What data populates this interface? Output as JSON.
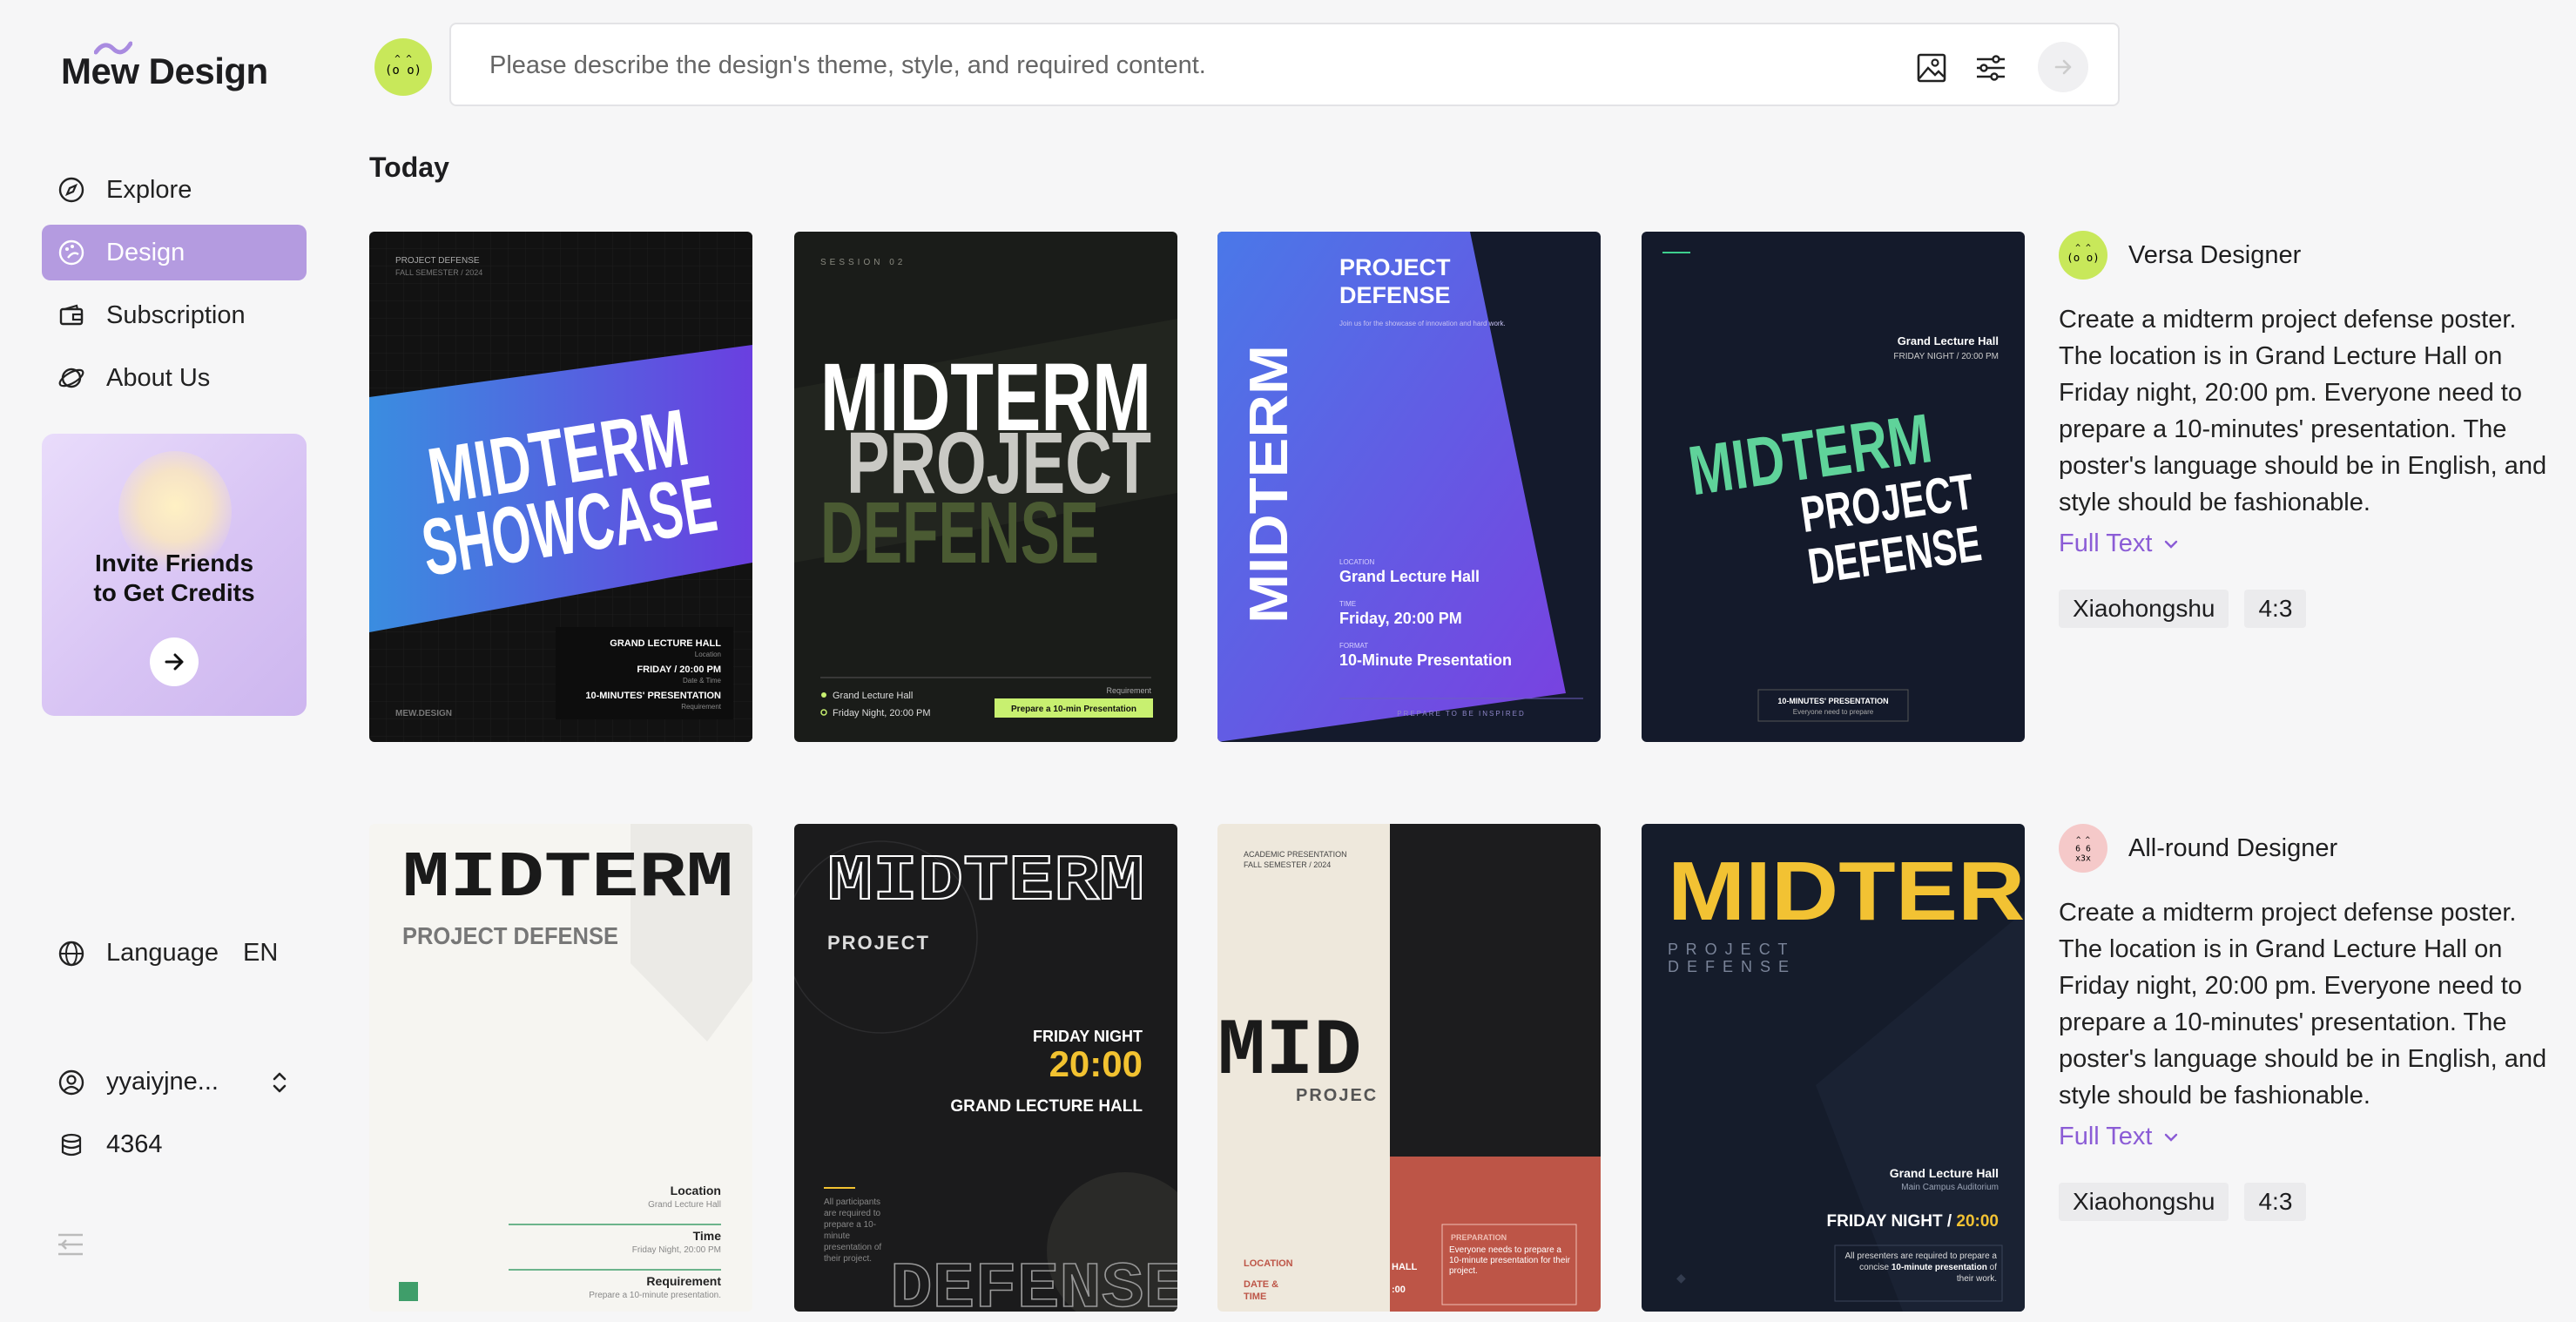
{
  "app": {
    "logo": "Mew Design"
  },
  "nav": [
    {
      "label": "Explore",
      "icon": "compass-icon"
    },
    {
      "label": "Design",
      "icon": "palette-icon",
      "active": true
    },
    {
      "label": "Subscription",
      "icon": "wallet-icon"
    },
    {
      "label": "About Us",
      "icon": "planet-icon"
    }
  ],
  "promo": {
    "line1": "Invite Friends",
    "line2": "to Get Credits"
  },
  "language": {
    "label": "Language",
    "code": "EN"
  },
  "user": {
    "name": "yyaiyjne...",
    "credits": "4364"
  },
  "prompt": {
    "placeholder": "Please describe the design's theme, style, and required content."
  },
  "section": {
    "title": "Today"
  },
  "colors": {
    "accent": "#b49be0",
    "link": "#8b5cd6"
  },
  "rows": [
    {
      "designer": "Versa Designer",
      "description": "Create a midterm project defense poster. The location is in Grand Lecture Hall on Friday night, 20:00 pm. Everyone need to prepare a 10-minutes' presentation. The poster's language should be in English, and style should be fashionable.",
      "full_text": "Full Text",
      "tags": [
        "Xiaohongshu",
        "4:3"
      ]
    },
    {
      "designer": "All-round Designer",
      "description": "Create a midterm project defense poster. The location is in Grand Lecture Hall on Friday night, 20:00 pm. Everyone need to prepare a 10-minutes' presentation. The poster's language should be in English, and style should be fashionable.",
      "full_text": "Full Text",
      "tags": [
        "Xiaohongshu",
        "4:3"
      ]
    }
  ],
  "posters": {
    "p1": {
      "top": "PROJECT DEFENSE",
      "sub": "FALL SEMESTER / 2024",
      "title1": "MIDTERM",
      "title2": "SHOWCASE",
      "l1": "GRAND LECTURE HALL",
      "l1s": "Location",
      "l2": "FRIDAY / 20:00 PM",
      "l2s": "Date & Time",
      "l3": "10-MINUTES' PRESENTATION",
      "l3s": "Requirement",
      "brand": "MEW.DESIGN"
    },
    "p2": {
      "top": "SESSION 02",
      "t1": "MIDTERM",
      "t2": "PROJECT",
      "t3": "DEFENSE",
      "b1": "Grand Lecture Hall",
      "b2": "Friday Night, 20:00 PM",
      "req": "Requirement",
      "badge": "Prepare a 10-min Presentation"
    },
    "p3": {
      "t1": "PROJECT",
      "t2": "DEFENSE",
      "sub": "Join us for the showcase of innovation and hard work.",
      "vert": "MIDTERM",
      "k1": "LOCATION",
      "v1": "Grand Lecture Hall",
      "k2": "TIME",
      "v2": "Friday, 20:00 PM",
      "k3": "FORMAT",
      "v3": "10-Minute Presentation",
      "foot": "PREPARE TO BE INSPIRED"
    },
    "p4": {
      "loc": "Grand Lecture Hall",
      "time": "FRIDAY NIGHT / 20:00 PM",
      "t1": "MIDTERM",
      "t2": "PROJECT",
      "t3": "DEFENSE",
      "box1": "10-MINUTES' PRESENTATION",
      "box2": "Everyone need to prepare"
    },
    "p5": {
      "t1": "MIDTERM",
      "t2": "PROJECT DEFENSE",
      "k1": "Location",
      "v1": "Grand Lecture Hall",
      "k2": "Time",
      "v2": "Friday Night, 20:00 PM",
      "k3": "Requirement",
      "v3": "Prepare a 10-minute presentation."
    },
    "p6": {
      "t1": "MIDTERM",
      "t2": "PROJECT",
      "fn": "FRIDAY NIGHT",
      "time": "20:00",
      "hall": "GRAND LECTURE HALL",
      "note": "All participants are required to prepare a 10-minute presentation of their project.",
      "def": "DEFENSE"
    },
    "p7": {
      "top1": "ACADEMIC PRESENTATION",
      "top2": "FALL SEMESTER / 2024",
      "big": "MID",
      "proj": "PROJEC",
      "loc": "LOCATION",
      "date": "DATE &",
      "time": "TIME",
      "hall": "HALL",
      "t0": ":00",
      "prep": "PREPARATION",
      "prepText": "Everyone needs to prepare a 10-minute presentation for their project."
    },
    "p8": {
      "t1": "MIDTERI",
      "t2": "P R O J E C T",
      "t3": "D E F E N S E",
      "hall": "Grand Lecture Hall",
      "audit": "Main Campus Auditorium",
      "fn": "FRIDAY NIGHT / ",
      "time": "20:00",
      "note1": "All presenters are required to prepare a concise ",
      "noteb": "10-minute presentation",
      "note2": " of their work."
    }
  }
}
